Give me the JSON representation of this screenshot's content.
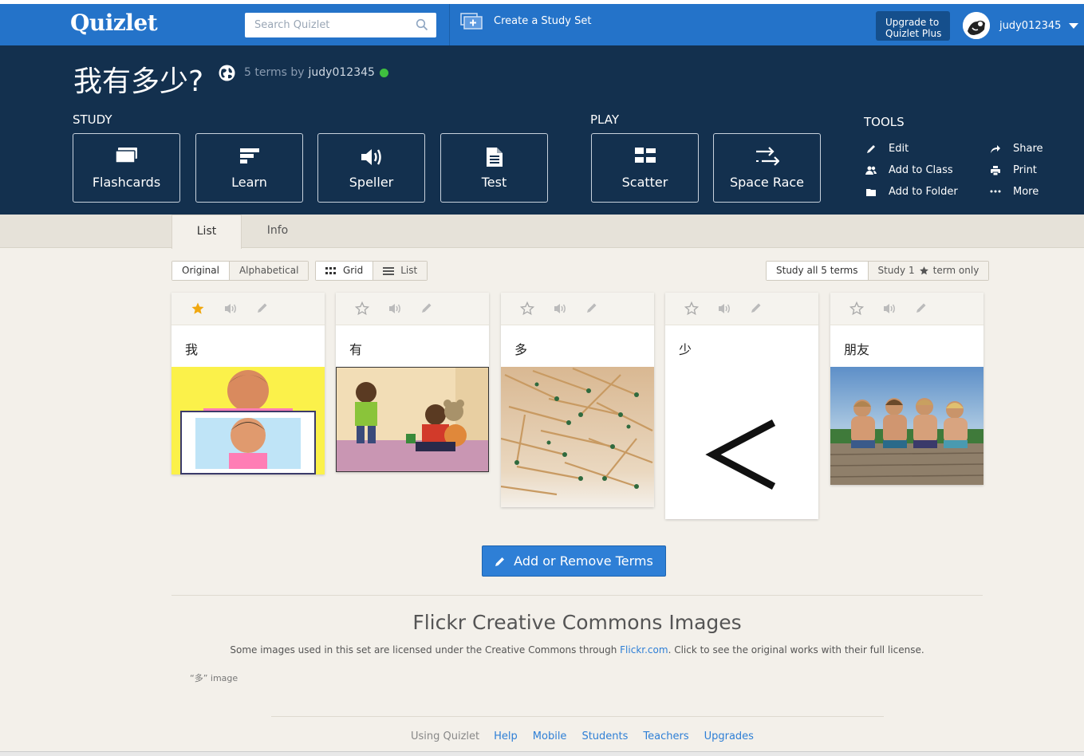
{
  "nav": {
    "logo": "Quizlet",
    "search_placeholder": "Search Quizlet",
    "create_label": "Create a Study Set",
    "upgrade_line1": "Upgrade to",
    "upgrade_line2": "Quizlet Plus",
    "username": "judy012345"
  },
  "set": {
    "title": "我有多少?",
    "terms_by": "5 terms by",
    "author": "judy012345"
  },
  "study": {
    "label": "STUDY",
    "buttons": [
      "Flashcards",
      "Learn",
      "Speller",
      "Test"
    ]
  },
  "play": {
    "label": "PLAY",
    "buttons": [
      "Scatter",
      "Space Race"
    ]
  },
  "tools": {
    "label": "TOOLS",
    "items": [
      "Edit",
      "Add to Class",
      "Add to Folder",
      "Share",
      "Print",
      "More"
    ]
  },
  "tabs": [
    "List",
    "Info"
  ],
  "toolbar": {
    "order": [
      "Original",
      "Alphabetical"
    ],
    "view": [
      "Grid",
      "List"
    ],
    "study_all": "Study all 5 terms",
    "study_starred_prefix": "Study 1",
    "study_starred_suffix": "term only"
  },
  "cards": [
    {
      "term": "我",
      "starred": true
    },
    {
      "term": "有",
      "starred": false
    },
    {
      "term": "多",
      "starred": false
    },
    {
      "term": "少",
      "starred": false
    },
    {
      "term": "朋友",
      "starred": false
    }
  ],
  "add_button": "Add or Remove Terms",
  "flickr": {
    "title": "Flickr Creative Commons Images",
    "text_before": "Some images used in this set are licensed under the Creative Commons through ",
    "link": "Flickr.com",
    "text_after": ". Click to see the original works with their full license.",
    "credit": "“多” image"
  },
  "footer": {
    "muted": "Using Quizlet",
    "links": [
      "Help",
      "Mobile",
      "Students",
      "Teachers",
      "Upgrades"
    ]
  },
  "colors": {
    "nav_blue": "#2473c9",
    "header_navy": "#13304e",
    "star_active": "#f0a810",
    "link_blue": "#2e7fd6"
  }
}
